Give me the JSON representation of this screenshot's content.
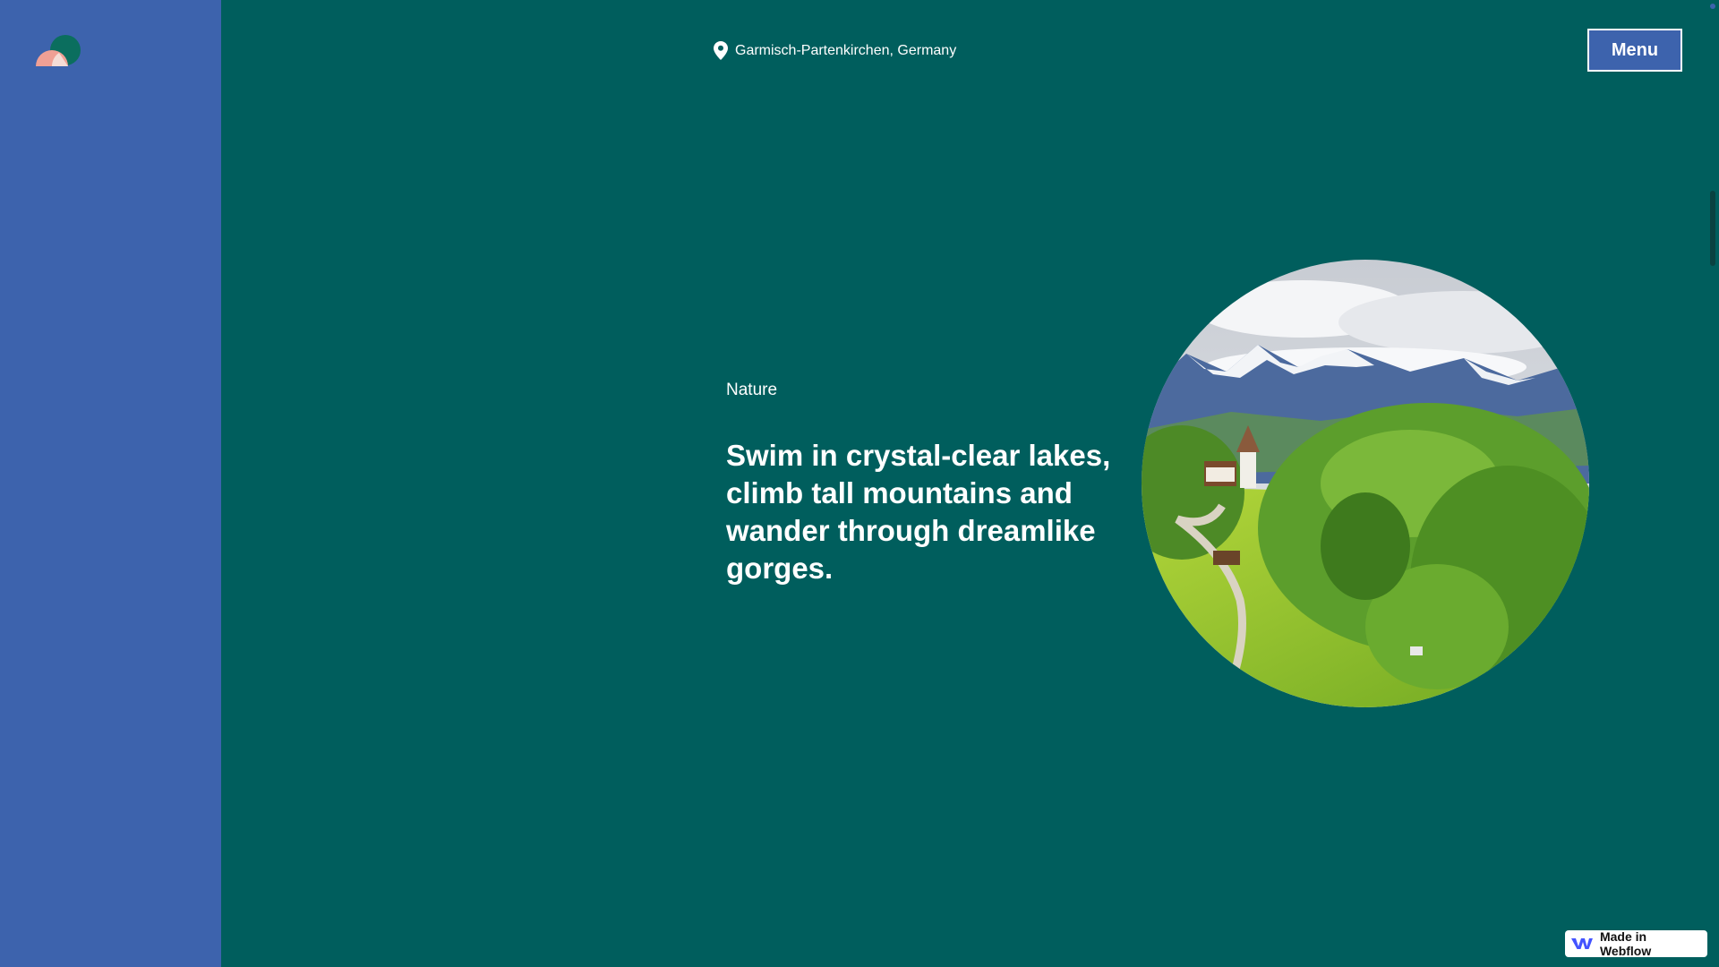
{
  "header": {
    "location": "Garmisch-Partenkirchen, Germany",
    "location_icon": "map-pin-icon",
    "menu_label": "Menu"
  },
  "hero": {
    "category": "Nature",
    "headline": "Swim in crystal-clear lakes, climb tall mountains and wander through dreamlike gorges."
  },
  "badge": {
    "label": "Made in Webflow",
    "icon": "webflow-logo-icon"
  },
  "colors": {
    "background": "#005e5d",
    "sidebar": "#3d63ad",
    "menu_button": "#3d63ad",
    "logo_pink": "#f0a095",
    "logo_green": "#0b6e5e"
  }
}
